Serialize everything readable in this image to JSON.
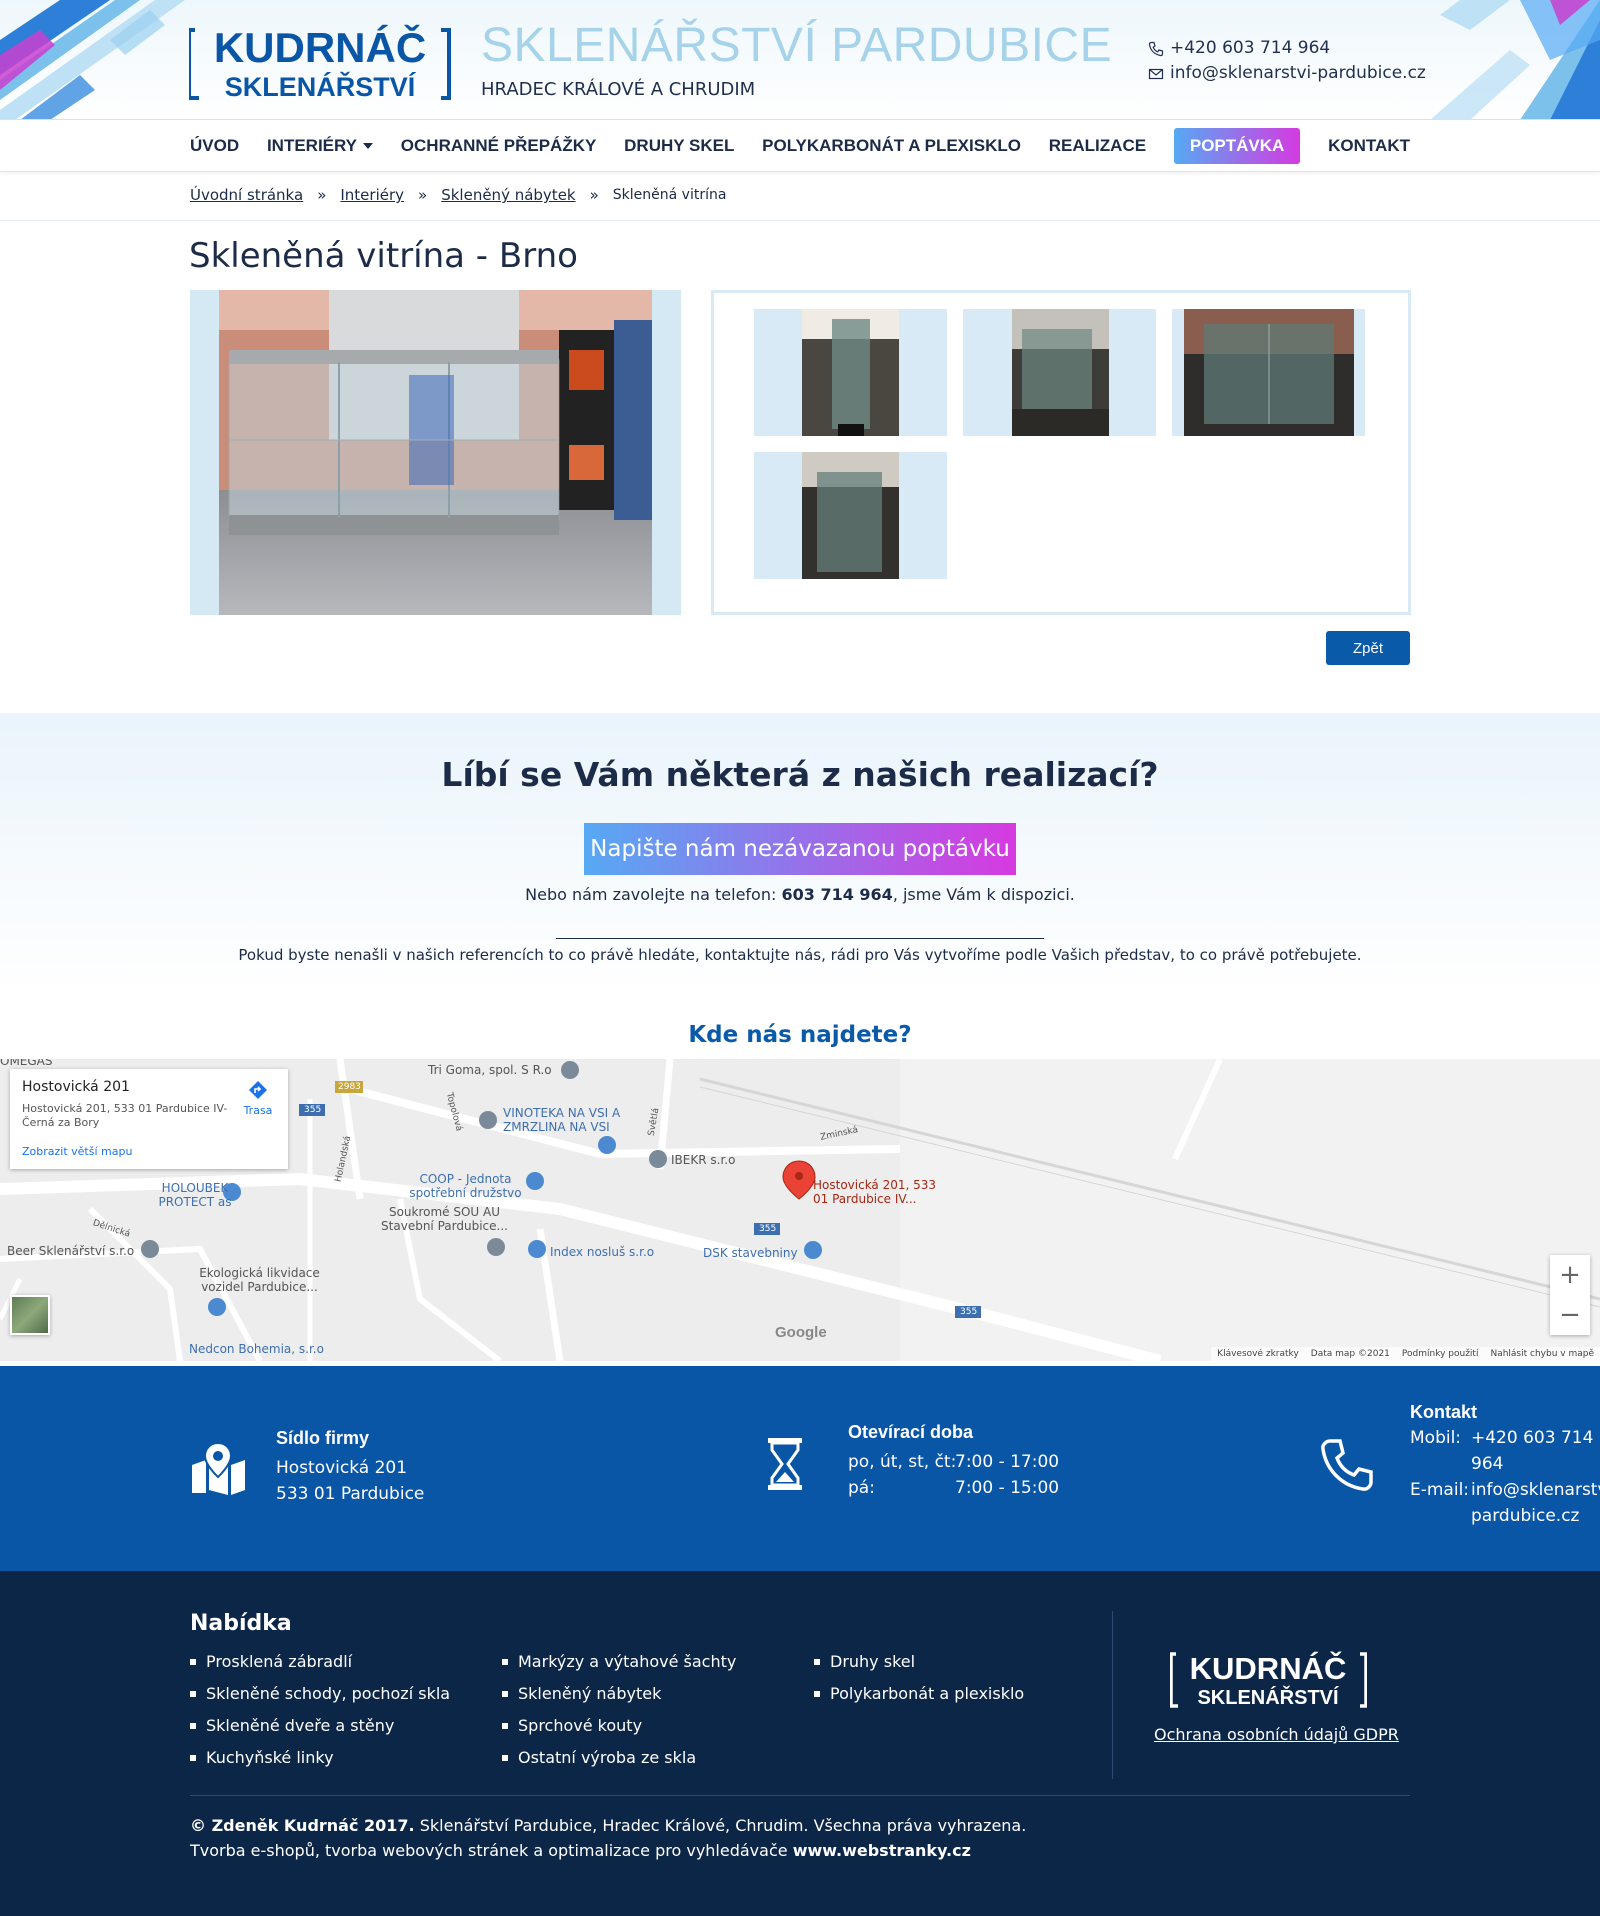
{
  "header": {
    "site_title": "SKLENÁŘSTVÍ PARDUBICE",
    "site_subtitle": "HRADEC KRÁLOVÉ A CHRUDIM",
    "logo_line1": "KUDRNÁČ",
    "logo_line2": "SKLENÁŘSTVÍ",
    "phone": "+420 603 714 964",
    "email": "info@sklenarstvi-pardubice.cz",
    "colors": {
      "title": "#a6d3ea",
      "brand_blue": "#0a56a6",
      "dark": "#1c2b47"
    }
  },
  "nav": {
    "items": [
      {
        "label": "ÚVOD"
      },
      {
        "label": "INTERIÉRY",
        "dropdown": true
      },
      {
        "label": "OCHRANNÉ PŘEPÁŽKY"
      },
      {
        "label": "DRUHY SKEL"
      },
      {
        "label": "POLYKARBONÁT A PLEXISKLO"
      },
      {
        "label": "REALIZACE"
      },
      {
        "label": "POPTÁVKA",
        "highlight": true
      },
      {
        "label": "KONTAKT"
      }
    ]
  },
  "breadcrumb": {
    "items": [
      "Úvodní stránka",
      "Interiéry",
      "Skleněný nábytek"
    ],
    "separator": "»",
    "current": "Skleněná vitrína"
  },
  "main": {
    "title": "Skleněná vitrína - Brno",
    "back_label": "Zpět",
    "thumbnail_count": 4
  },
  "cta": {
    "title": "Líbí se Vám některá z našich realizací?",
    "button": "Napište nám nezávazanou poptávku",
    "phone_prefix": "Nebo nám zavolejte na telefon: ",
    "phone": "603 714 964",
    "phone_suffix": ", jsme Vám k dispozici.",
    "note": "Pokud byste nenašli v našich referencích to co právě hledáte, kontaktujte nás, rádi pro Vás vytvoříme podle Vašich představ, to co právě potřebujete."
  },
  "map": {
    "heading": "Kde nás najdete?",
    "card_name": "Hostovická 201",
    "card_address": "Hostovická 201, 533 01 Pardubice IV-Černá za Bory",
    "card_bigger_map": "Zobrazit větší mapu",
    "card_route": "Trasa",
    "marker_label": "Hostovická 201, 533 01 Pardubice IV...",
    "labels": {
      "omegas": "OMEGAS",
      "tri_goma": "Tri Goma, spol. S R.o",
      "vinoteka": "VINOTEKA NA VSI A ZMRZLINA NA VSI",
      "ibekr": "IBEKR s.r.o",
      "holoubek": "HOLOUBEK PROTECT as",
      "coop": "COOP - Jednota spotřební družstvo",
      "sou": "Soukromé SOU AU Stavební Pardubice...",
      "beer": "Beer Sklenářství s.r.o",
      "index": "Index nosluš s.r.o",
      "dsk": "DSK stavebniny",
      "eko": "Ekologická likvidace vozidel Pardubice...",
      "nedcon": "Nedcon Bohemia, s.r.o",
      "zminska": "Zminská",
      "delnicka": "Dělnická",
      "holandska": "Holandská",
      "svetla": "Světlá",
      "topolova": "Topolová",
      "road_355_a": "355",
      "road_355_b": "355",
      "road_355_c": "355",
      "road_2983": "2983"
    },
    "google": "Google",
    "footer_items": [
      "Klávesové zkratky",
      "Data map ©2021",
      "Podmínky použití",
      "Nahlásit chybu v mapě"
    ],
    "zoom_in": "+",
    "zoom_out": "−"
  },
  "info": {
    "hq_title": "Sídlo firmy",
    "hq_line1": "Hostovická 201",
    "hq_line2": "533 01 Pardubice",
    "hours_title": "Otevírací doba",
    "hours": [
      {
        "days": "po, út, st, čt:",
        "time": "7:00 - 17:00"
      },
      {
        "days": "pá:",
        "time": "7:00 - 15:00"
      }
    ],
    "contact_title": "Kontakt",
    "mobile_label": "Mobil:",
    "mobile_value_1": "+420 603 714",
    "mobile_value_2": "964",
    "email_label": "E-mail:",
    "email_value_1": "info@sklenarstvi-",
    "email_value_2": "pardubice.cz"
  },
  "footer": {
    "title": "Nabídka",
    "col1": [
      "Prosklená zábradlí",
      "Skleněné schody, pochozí skla",
      "Skleněné dveře a stěny",
      "Kuchyňské linky"
    ],
    "col2": [
      "Markýzy a výtahové šachty",
      "Skleněný nábytek",
      "Sprchové kouty",
      "Ostatní výroba ze skla"
    ],
    "col3": [
      "Druhy skel",
      "Polykarbonát a plexisklo"
    ],
    "gdpr": "Ochrana osobních údajů GDPR",
    "copy_bold": "© Zdeněk Kudrnáč 2017.",
    "copy_rest": " Sklenářství Pardubice, Hradec Králové, Chrudim. Všechna práva vyhrazena.",
    "credit_rest": "Tvorba e-shopů, tvorba webových stránek a optimalizace pro vyhledávače ",
    "credit_bold": "www.webstranky.cz"
  }
}
